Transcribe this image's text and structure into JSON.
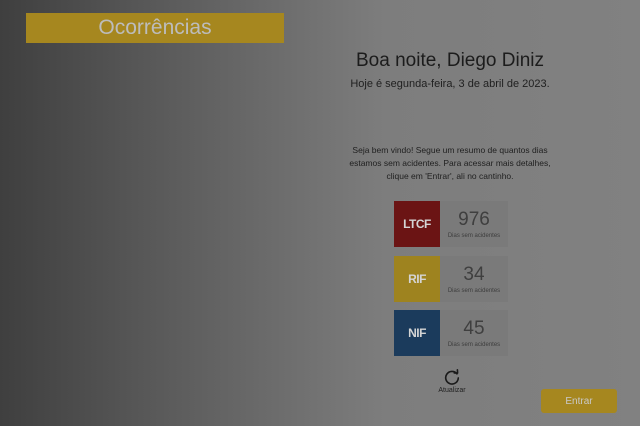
{
  "header": {
    "title": "Ocorrências"
  },
  "greeting": {
    "text": "Boa noite, Diego Diniz",
    "date": "Hoje é segunda-feira, 3 de abril de 2023."
  },
  "intro": "Seja bem vindo! Segue um resumo de quantos dias estamos sem acidentes. Para acessar mais detalhes, clique em 'Entrar', ali no cantinho.",
  "stats": [
    {
      "code": "LTCF",
      "count": "976",
      "caption": "Dias sem acidentes",
      "color": "#6b1414"
    },
    {
      "code": "RIF",
      "count": "34",
      "caption": "Dias sem acidentes",
      "color": "#9e831f"
    },
    {
      "code": "NIF",
      "count": "45",
      "caption": "Dias sem acidentes",
      "color": "#1b3b5c"
    }
  ],
  "refresh": {
    "label": "Atualizar",
    "icon": "refresh-icon"
  },
  "actions": {
    "enter_label": "Entrar"
  },
  "colors": {
    "accent": "#a6871f"
  }
}
